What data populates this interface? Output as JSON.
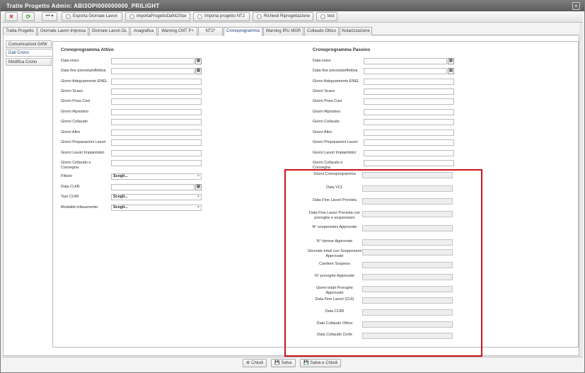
{
  "window": {
    "title": "Tratte Progetto Admin: ABI3OPI000000000_PRILIGHT"
  },
  "toolbar": {
    "esporta": "Esporta Giornale Lavori",
    "importa_dal": "importaProgettoDaNt2Star",
    "importa_nt2": "Importa progetto NT2",
    "richiedi": "Richiedi Riprogettazione",
    "test": "test",
    "more": "•••"
  },
  "tabs": [
    "Tratta Progetto",
    "Giornale Lavori Impresa",
    "Giornale Lavori DL",
    "Anagrafica",
    "Warning CMT P+",
    "NT2*",
    "Cronoprogramma",
    "Warning IRU MGR",
    "Collaudo Ottico",
    "Notarizzazione"
  ],
  "sidebar": [
    "Comunicazioni G4W",
    "Dati Crono",
    "Modifica Crono"
  ],
  "attivo": {
    "title": "Cronoprogramma Attivo",
    "fields": [
      "Data inizio",
      "Data fine prevista/effettiva",
      "Giorni Adeguamento ENEL",
      "Giorni Scavo",
      "Giorni Posa Cavi",
      "Giorni Ripristino",
      "Giorni Collaudo",
      "Giorni Altro",
      "Giorni Preparazioni Lavori",
      "Giorni Lavori Impiantistici",
      "Giorni Collaudo e Consegna"
    ],
    "fittizio": "Fittizio",
    "data_cuir": "Data CUIR",
    "tipo_cuir": "Tipo CUIR",
    "modalita": "Modalità infasamento",
    "select_value": "Scegli..."
  },
  "passivo": {
    "title": "Cronoprogramma Passivo",
    "fields": [
      "Data inizio",
      "Data fine prevista/effettiva",
      "Giorni Adeguamento ENEL",
      "Giorni Scavo",
      "Giorni Posa Cavi",
      "Giorni Ripristino",
      "Giorni Collaudo",
      "Giorni Altro",
      "Giorni Preparazioni Lavori",
      "Giorni Lavori Impiantistici",
      "Giorni Collaudo e Consegna"
    ],
    "extra": [
      "Giorni Cronoprogramma",
      "Data VCL",
      "Data Fine Lavori Prevista",
      "Data Fine Lavori Prevista con proroghe e sospensioni",
      "N° sospensioni Approvate",
      "N° riprese Approvate",
      "Giornate totali con Sospensioni Approvate",
      "Cantiere Sospeso",
      "N° proroghe Approvate",
      "Giorni totali Proroghe Approvate",
      "Data Fine Lavori (CUI)",
      "Data CUIR",
      "Data Collaudo Ottico",
      "Data Collaudo Civile"
    ]
  },
  "footer": {
    "chiudi": "Chiudi",
    "salva": "Salva",
    "salva_chiudi": "Salva e Chiudi"
  },
  "colors": {
    "highlight": "#c8151e",
    "titlebar": "#6a6a6a"
  }
}
